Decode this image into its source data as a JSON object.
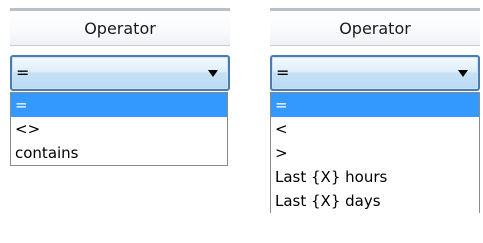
{
  "left_panel": {
    "header": "Operator",
    "combo_value": "=",
    "options": [
      "=",
      "<>",
      "contains"
    ],
    "selected_index": 0
  },
  "right_panel": {
    "header": "Operator",
    "combo_value": "=",
    "options": [
      "=",
      "<",
      ">",
      "Last {X} hours",
      "Last {X} days"
    ],
    "selected_index": 0
  },
  "colors": {
    "selection": "#3399ff",
    "combo_border": "#4a7bb1"
  },
  "icons": {
    "dropdown_arrow": "chevron-down-icon"
  }
}
